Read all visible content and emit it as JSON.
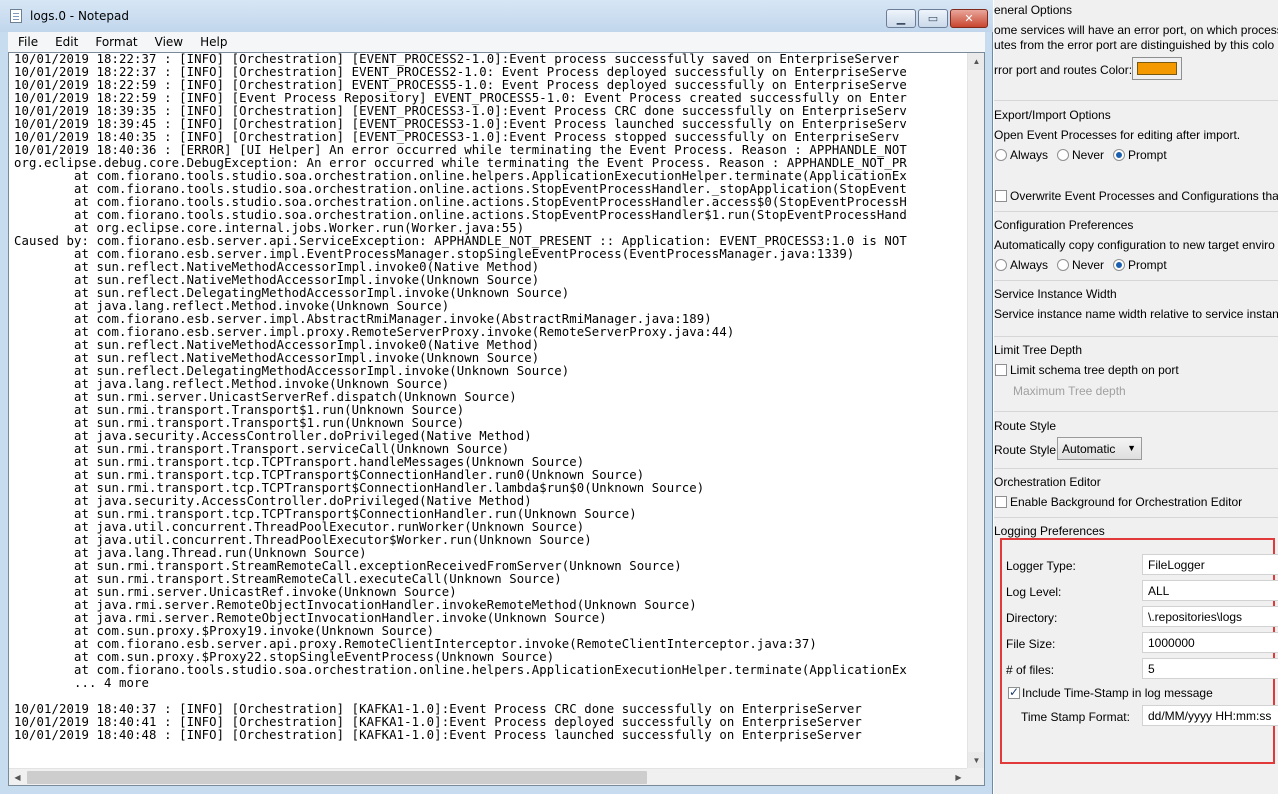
{
  "window": {
    "title": "logs.0 - Notepad"
  },
  "menu": {
    "file": "File",
    "edit": "Edit",
    "format": "Format",
    "view": "View",
    "help": "Help"
  },
  "log_lines": [
    "10/01/2019 18:22:37 : [INFO] [Orchestration] [EVENT_PROCESS2-1.0]:Event process successfully saved on EnterpriseServer",
    "10/01/2019 18:22:37 : [INFO] [Orchestration] EVENT_PROCESS2-1.0: Event Process deployed successfully on EnterpriseServe",
    "10/01/2019 18:22:59 : [INFO] [Orchestration] EVENT_PROCESS5-1.0: Event Process deployed successfully on EnterpriseServe",
    "10/01/2019 18:22:59 : [INFO] [Event Process Repository] EVENT_PROCESS5-1.0: Event Process created successfully on Enter",
    "10/01/2019 18:39:35 : [INFO] [Orchestration] [EVENT_PROCESS3-1.0]:Event Process CRC done successfully on EnterpriseServ",
    "10/01/2019 18:39:45 : [INFO] [Orchestration] [EVENT_PROCESS3-1.0]:Event Process launched successfully on EnterpriseServ",
    "10/01/2019 18:40:35 : [INFO] [Orchestration] [EVENT_PROCESS3-1.0]:Event Process stopped successfully on EnterpriseServ",
    "10/01/2019 18:40:36 : [ERROR] [UI Helper] An error occurred while terminating the Event Process. Reason : APPHANDLE_NOT",
    "org.eclipse.debug.core.DebugException: An error occurred while terminating the Event Process. Reason : APPHANDLE_NOT_PR",
    "        at com.fiorano.tools.studio.soa.orchestration.online.helpers.ApplicationExecutionHelper.terminate(ApplicationEx",
    "        at com.fiorano.tools.studio.soa.orchestration.online.actions.StopEventProcessHandler._stopApplication(StopEvent",
    "        at com.fiorano.tools.studio.soa.orchestration.online.actions.StopEventProcessHandler.access$0(StopEventProcessH",
    "        at com.fiorano.tools.studio.soa.orchestration.online.actions.StopEventProcessHandler$1.run(StopEventProcessHand",
    "        at org.eclipse.core.internal.jobs.Worker.run(Worker.java:55)",
    "Caused by: com.fiorano.esb.server.api.ServiceException: APPHANDLE_NOT_PRESENT :: Application: EVENT_PROCESS3:1.0 is NOT",
    "        at com.fiorano.esb.server.impl.EventProcessManager.stopSingleEventProcess(EventProcessManager.java:1339)",
    "        at sun.reflect.NativeMethodAccessorImpl.invoke0(Native Method)",
    "        at sun.reflect.NativeMethodAccessorImpl.invoke(Unknown Source)",
    "        at sun.reflect.DelegatingMethodAccessorImpl.invoke(Unknown Source)",
    "        at java.lang.reflect.Method.invoke(Unknown Source)",
    "        at com.fiorano.esb.server.impl.AbstractRmiManager.invoke(AbstractRmiManager.java:189)",
    "        at com.fiorano.esb.server.impl.proxy.RemoteServerProxy.invoke(RemoteServerProxy.java:44)",
    "        at sun.reflect.NativeMethodAccessorImpl.invoke0(Native Method)",
    "        at sun.reflect.NativeMethodAccessorImpl.invoke(Unknown Source)",
    "        at sun.reflect.DelegatingMethodAccessorImpl.invoke(Unknown Source)",
    "        at java.lang.reflect.Method.invoke(Unknown Source)",
    "        at sun.rmi.server.UnicastServerRef.dispatch(Unknown Source)",
    "        at sun.rmi.transport.Transport$1.run(Unknown Source)",
    "        at sun.rmi.transport.Transport$1.run(Unknown Source)",
    "        at java.security.AccessController.doPrivileged(Native Method)",
    "        at sun.rmi.transport.Transport.serviceCall(Unknown Source)",
    "        at sun.rmi.transport.tcp.TCPTransport.handleMessages(Unknown Source)",
    "        at sun.rmi.transport.tcp.TCPTransport$ConnectionHandler.run0(Unknown Source)",
    "        at sun.rmi.transport.tcp.TCPTransport$ConnectionHandler.lambda$run$0(Unknown Source)",
    "        at java.security.AccessController.doPrivileged(Native Method)",
    "        at sun.rmi.transport.tcp.TCPTransport$ConnectionHandler.run(Unknown Source)",
    "        at java.util.concurrent.ThreadPoolExecutor.runWorker(Unknown Source)",
    "        at java.util.concurrent.ThreadPoolExecutor$Worker.run(Unknown Source)",
    "        at java.lang.Thread.run(Unknown Source)",
    "        at sun.rmi.transport.StreamRemoteCall.exceptionReceivedFromServer(Unknown Source)",
    "        at sun.rmi.transport.StreamRemoteCall.executeCall(Unknown Source)",
    "        at sun.rmi.server.UnicastRef.invoke(Unknown Source)",
    "        at java.rmi.server.RemoteObjectInvocationHandler.invokeRemoteMethod(Unknown Source)",
    "        at java.rmi.server.RemoteObjectInvocationHandler.invoke(Unknown Source)",
    "        at com.sun.proxy.$Proxy19.invoke(Unknown Source)",
    "        at com.fiorano.esb.server.api.proxy.RemoteClientInterceptor.invoke(RemoteClientInterceptor.java:37)",
    "        at com.sun.proxy.$Proxy22.stopSingleEventProcess(Unknown Source)",
    "        at com.fiorano.tools.studio.soa.orchestration.online.helpers.ApplicationExecutionHelper.terminate(ApplicationEx",
    "        ... 4 more",
    "",
    "10/01/2019 18:40:37 : [INFO] [Orchestration] [KAFKA1-1.0]:Event Process CRC done successfully on EnterpriseServer",
    "10/01/2019 18:40:41 : [INFO] [Orchestration] [KAFKA1-1.0]:Event Process deployed successfully on EnterpriseServer",
    "10/01/2019 18:40:48 : [INFO] [Orchestration] [KAFKA1-1.0]:Event Process launched successfully on EnterpriseServer"
  ],
  "prefs": {
    "general_header": "eneral Options",
    "general_text1": "ome services will have an error port, on which processi",
    "general_text2": "utes from the error port are distinguished by this colo",
    "error_port_label": "rror port and routes Color:",
    "error_port_color": "#f49a00",
    "export_header": "Export/Import Options",
    "export_text": "Open Event Processes for editing after import.",
    "export_radio_always": "Always",
    "export_radio_never": "Never",
    "export_radio_prompt": "Prompt",
    "overwrite_label": "Overwrite Event Processes and Configurations that",
    "config_header": "Configuration Preferences",
    "config_text": "Automatically copy configuration to new target enviro",
    "config_radio_always": "Always",
    "config_radio_never": "Never",
    "config_radio_prompt": "Prompt",
    "service_header": "Service Instance Width",
    "service_text": "Service instance name width relative to service instanc",
    "limit_header": "Limit Tree Depth",
    "limit_checkbox": "Limit schema tree depth on port",
    "max_depth_label": "Maximum Tree depth",
    "route_header": "Route Style",
    "route_label": "Route Style",
    "route_value": "Automatic",
    "orch_header": "Orchestration Editor",
    "orch_checkbox": "Enable Background for Orchestration Editor",
    "logging_header": "Logging Preferences",
    "logger_type_label": "Logger Type:",
    "logger_type_value": "FileLogger",
    "log_level_label": "Log Level:",
    "log_level_value": "ALL",
    "directory_label": "Directory:",
    "directory_value": "\\.repositories\\logs",
    "file_size_label": "File Size:",
    "file_size_value": "1000000",
    "num_files_label": "# of files:",
    "num_files_value": "5",
    "timestamp_checkbox": "Include Time-Stamp in log message",
    "timestamp_format_label": "Time Stamp Format:",
    "timestamp_format_value": "dd/MM/yyyy HH:mm:ss"
  }
}
